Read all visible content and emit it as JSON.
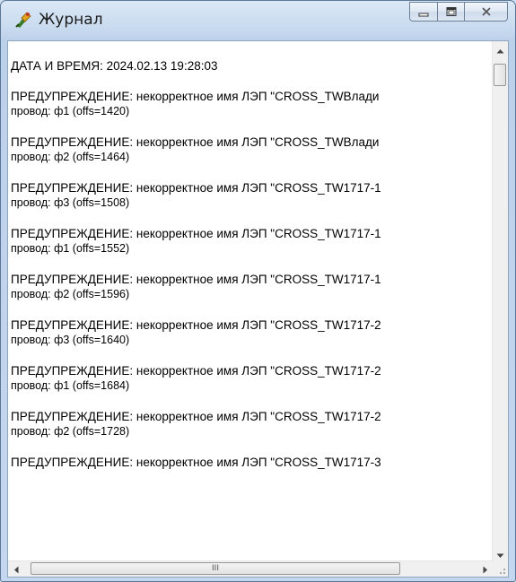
{
  "window": {
    "title": "Журнал"
  },
  "log": {
    "header": "ДАТА И ВРЕМЯ: 2024.02.13 19:28:03",
    "entries": [
      {
        "line1": "ПРЕДУПРЕЖДЕНИЕ: некорректное имя ЛЭП \"CROSS_TWВлади",
        "line2": "провод: ф1 (offs=1420)"
      },
      {
        "line1": "ПРЕДУПРЕЖДЕНИЕ: некорректное имя ЛЭП \"CROSS_TWВлади",
        "line2": "провод: ф2 (offs=1464)"
      },
      {
        "line1": "ПРЕДУПРЕЖДЕНИЕ: некорректное имя ЛЭП \"CROSS_TW1717-1",
        "line2": "провод: ф3 (offs=1508)"
      },
      {
        "line1": "ПРЕДУПРЕЖДЕНИЕ: некорректное имя ЛЭП \"CROSS_TW1717-1",
        "line2": "провод: ф1 (offs=1552)"
      },
      {
        "line1": "ПРЕДУПРЕЖДЕНИЕ: некорректное имя ЛЭП \"CROSS_TW1717-1",
        "line2": "провод: ф2 (offs=1596)"
      },
      {
        "line1": "ПРЕДУПРЕЖДЕНИЕ: некорректное имя ЛЭП \"CROSS_TW1717-2",
        "line2": "провод: ф3 (offs=1640)"
      },
      {
        "line1": "ПРЕДУПРЕЖДЕНИЕ: некорректное имя ЛЭП \"CROSS_TW1717-2",
        "line2": "провод: ф1 (offs=1684)"
      },
      {
        "line1": "ПРЕДУПРЕЖДЕНИЕ: некорректное имя ЛЭП \"CROSS_TW1717-2",
        "line2": "провод: ф2 (offs=1728)"
      },
      {
        "line1": "ПРЕДУПРЕЖДЕНИЕ: некорректное имя ЛЭП \"CROSS_TW1717-3",
        "line2": ""
      }
    ]
  },
  "scrollbars": {
    "horizontal_thumb_grip": "III"
  },
  "icons": {
    "app": "journal-app-icon",
    "minimize": "minimize-icon",
    "maximize": "maximize-icon",
    "close": "close-icon"
  },
  "colors": {
    "title_bar": "#c9dbef",
    "content_bg": "#ffffff",
    "text": "#000000"
  }
}
